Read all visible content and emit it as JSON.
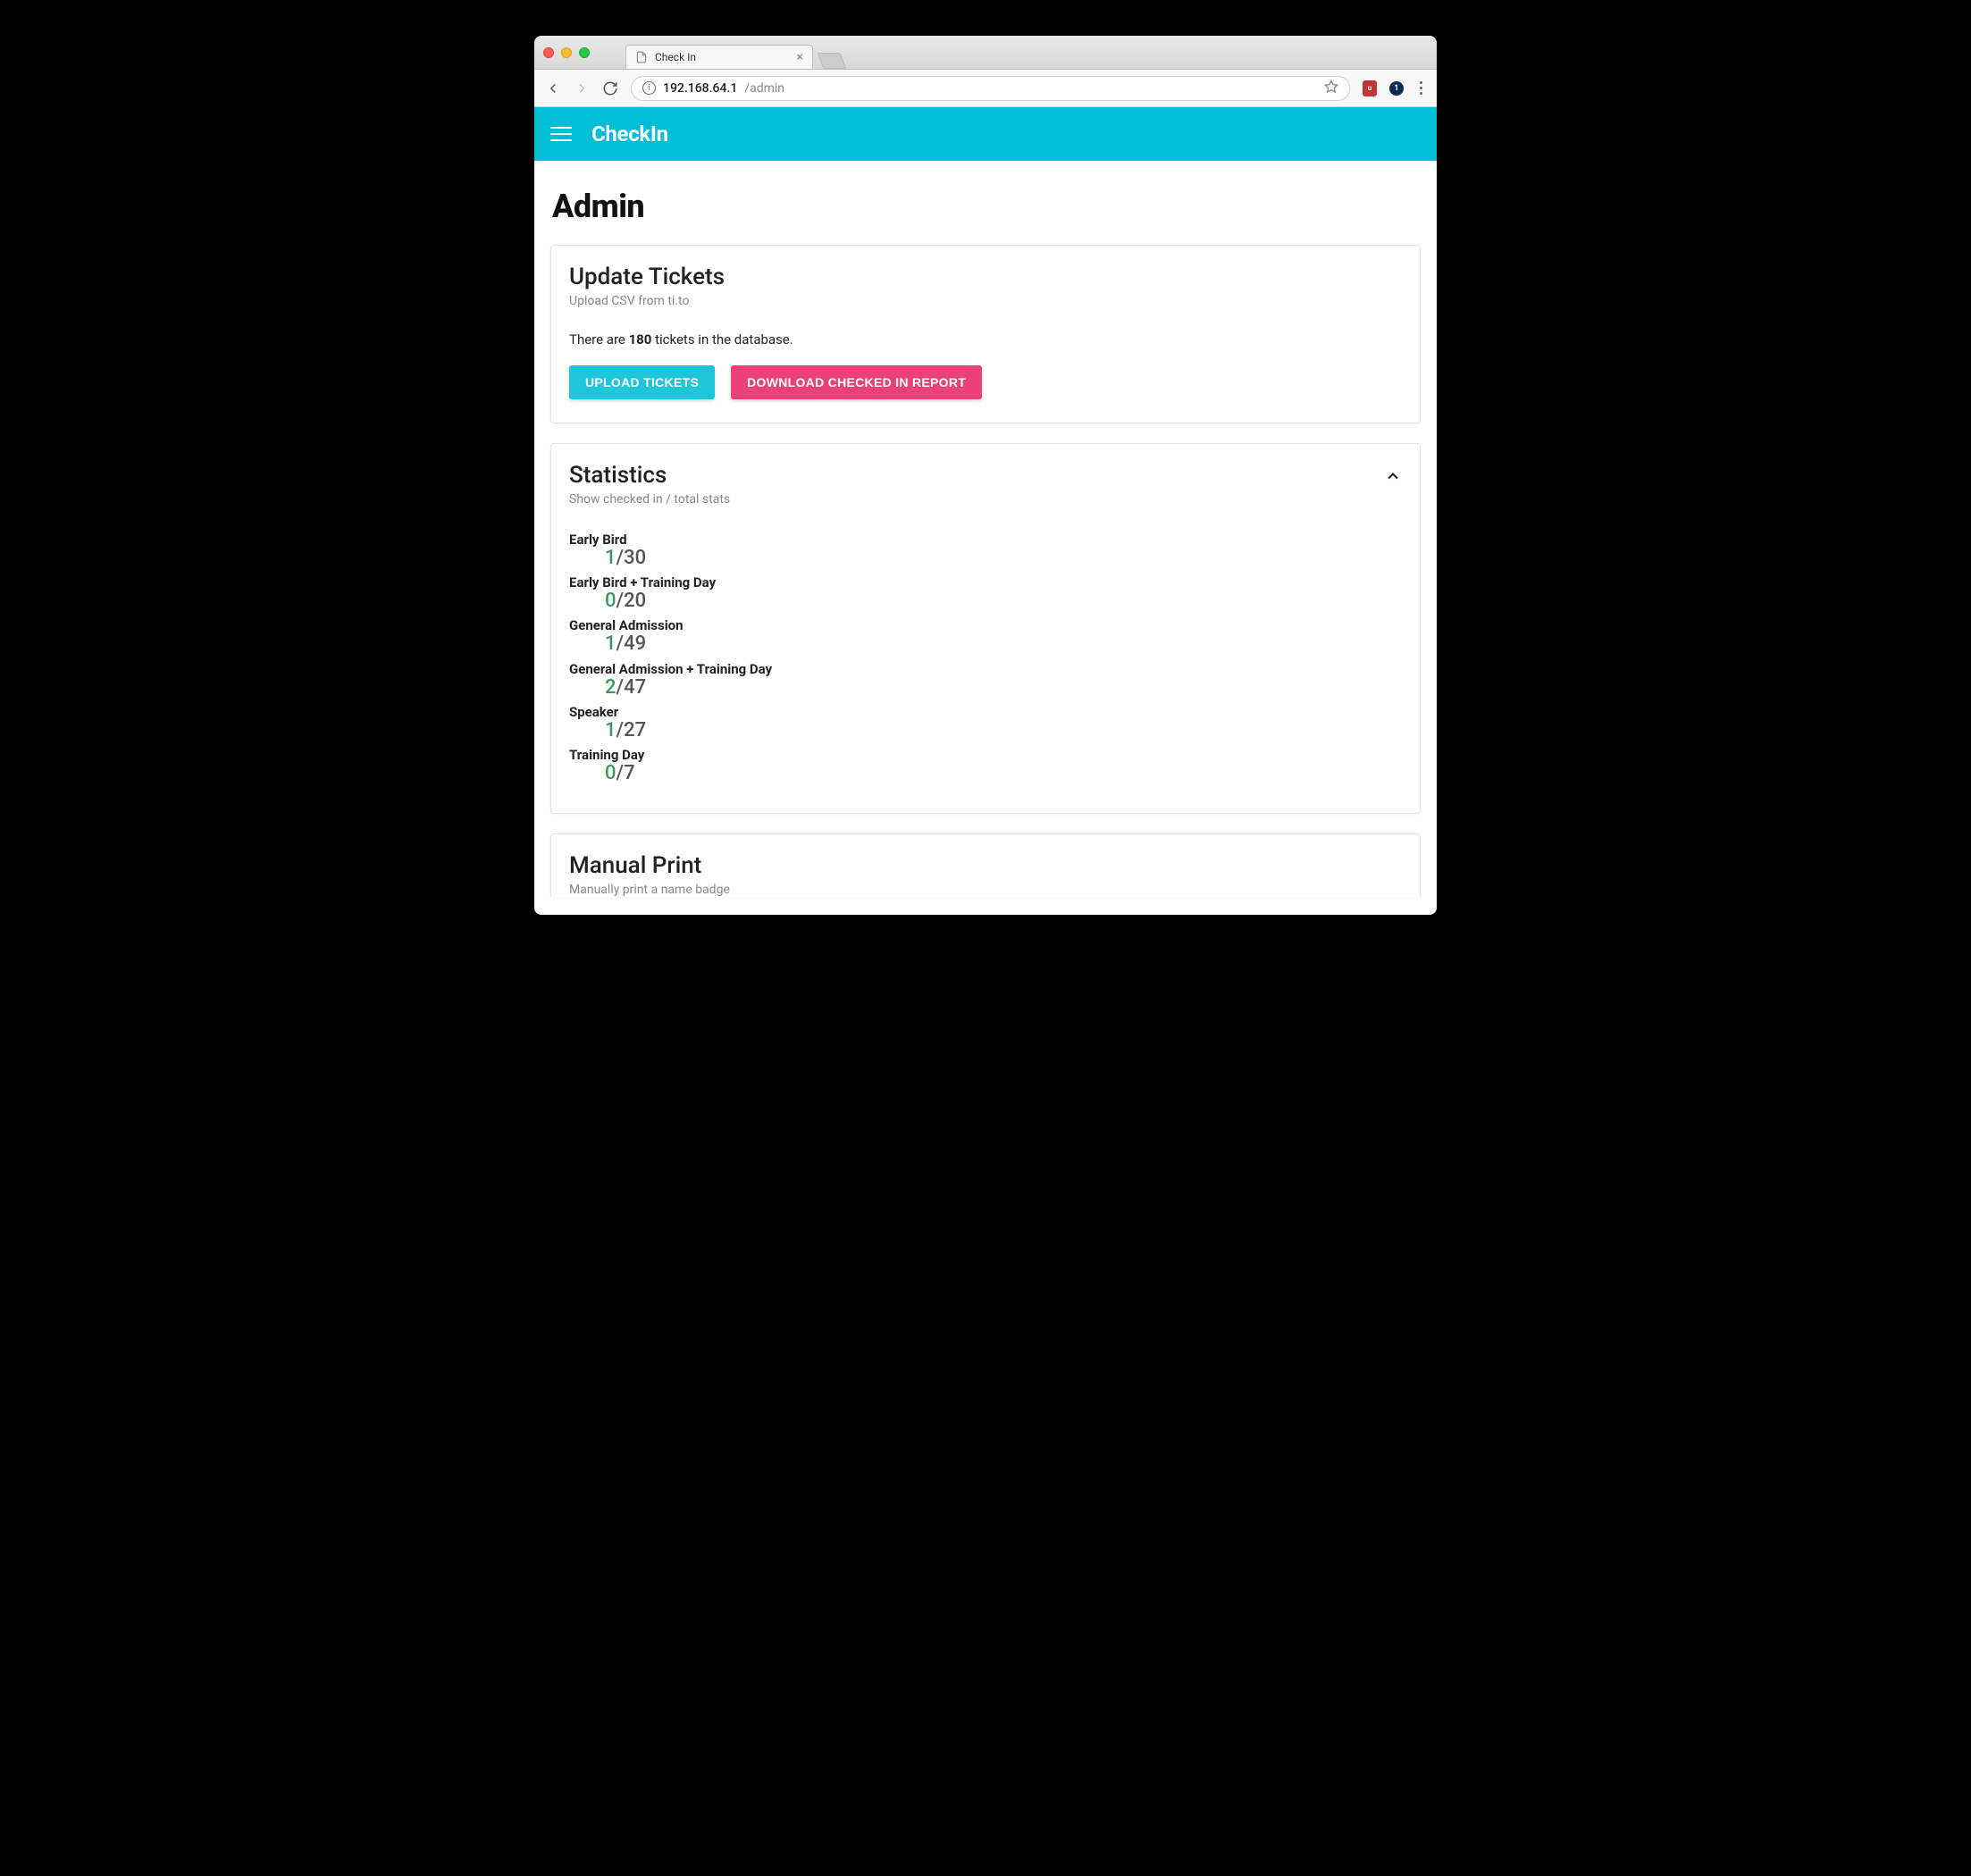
{
  "browser": {
    "tab_title": "Check In",
    "url_host": "192.168.64.1",
    "url_path": "/admin",
    "ext_badge_count": "1"
  },
  "appbar": {
    "brand": "CheckIn"
  },
  "page": {
    "title": "Admin"
  },
  "update_card": {
    "heading": "Update Tickets",
    "sub": "Upload CSV from ti.to",
    "line_pre": "There are ",
    "count": "180",
    "line_post": " tickets in the database.",
    "upload_label": "UPLOAD TICKETS",
    "download_label": "DOWNLOAD CHECKED IN REPORT"
  },
  "stats_card": {
    "heading": "Statistics",
    "sub": "Show checked in / total stats",
    "items": [
      {
        "label": "Early Bird",
        "checked_in": "1",
        "total": "30"
      },
      {
        "label": "Early Bird + Training Day",
        "checked_in": "0",
        "total": "20"
      },
      {
        "label": "General Admission",
        "checked_in": "1",
        "total": "49"
      },
      {
        "label": "General Admission + Training Day",
        "checked_in": "2",
        "total": "47"
      },
      {
        "label": "Speaker",
        "checked_in": "1",
        "total": "27"
      },
      {
        "label": "Training Day",
        "checked_in": "0",
        "total": "7"
      }
    ]
  },
  "manual_card": {
    "heading": "Manual Print",
    "sub": "Manually print a name badge"
  }
}
